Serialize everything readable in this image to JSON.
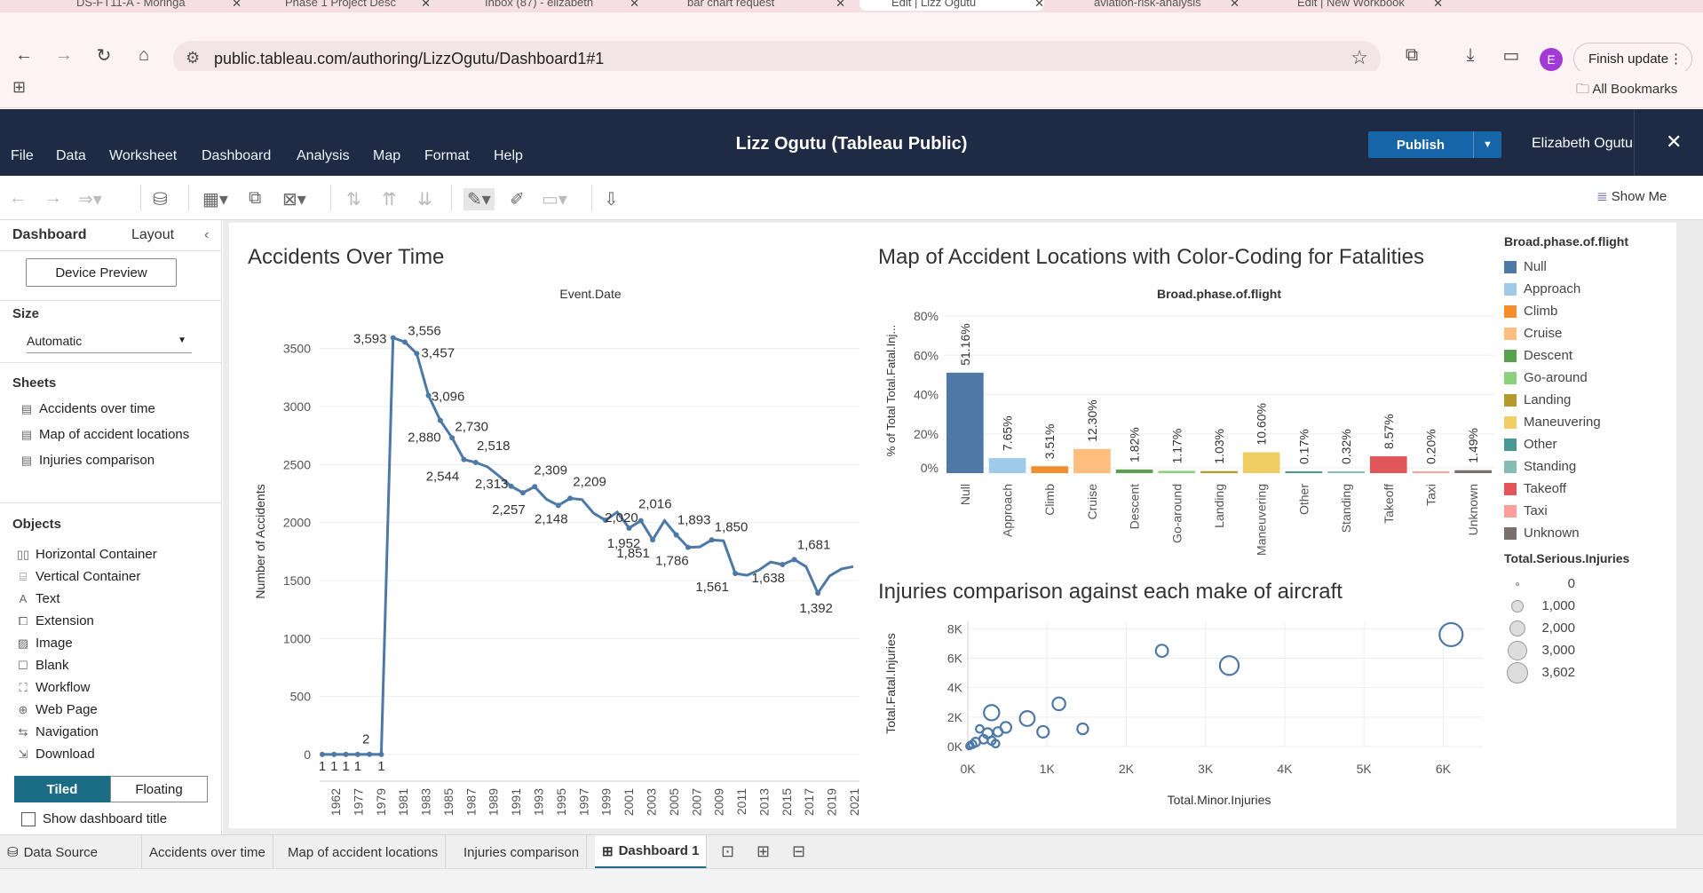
{
  "browser": {
    "tabs": [
      {
        "label": "DS-FT11-A - Moringa"
      },
      {
        "label": "Phase 1 Project Desc"
      },
      {
        "label": "Inbox (87) - elizabeth"
      },
      {
        "label": "bar chart request"
      },
      {
        "label": "Edit | Lizz Ogutu"
      },
      {
        "label": "aviation-risk-analysis"
      },
      {
        "label": "Edit | New Workbook"
      }
    ],
    "url": "public.tableau.com/authoring/LizzOgutu/Dashboard1#1",
    "profile_initial": "E",
    "finish_update": "Finish update",
    "all_bookmarks": "All Bookmarks"
  },
  "tableau": {
    "menu": [
      "File",
      "Data",
      "Worksheet",
      "Dashboard",
      "Analysis",
      "Map",
      "Format",
      "Help"
    ],
    "title": "Lizz Ogutu (Tableau Public)",
    "publish": "Publish",
    "user": "Elizabeth Ogutu",
    "show_me": "Show Me"
  },
  "left_pane": {
    "tab_dashboard": "Dashboard",
    "tab_layout": "Layout",
    "device_preview": "Device Preview",
    "size_heading": "Size",
    "size_value": "Automatic",
    "sheets_heading": "Sheets",
    "sheets": [
      "Accidents over time",
      "Map of accident locations",
      "Injuries comparison"
    ],
    "objects_heading": "Objects",
    "objects": [
      "Horizontal Container",
      "Vertical Container",
      "Text",
      "Extension",
      "Image",
      "Blank",
      "Workflow",
      "Web Page",
      "Navigation",
      "Download"
    ],
    "tiled": "Tiled",
    "floating": "Floating",
    "show_title": "Show dashboard title"
  },
  "bottom_tabs": {
    "data_source": "Data Source",
    "sheets": [
      "Accidents over time",
      "Map of accident locations",
      "Injuries comparison"
    ],
    "active": "Dashboard 1"
  },
  "chart_data": [
    {
      "type": "line",
      "title": "Accidents Over Time",
      "header": "Event.Date",
      "ylabel": "Number of Accidents",
      "ylim": [
        0,
        3600
      ],
      "yticks": [
        0,
        500,
        1000,
        1500,
        2000,
        2500,
        3000,
        3500
      ],
      "xticks": [
        "1962",
        "1977",
        "1979",
        "1981",
        "1983",
        "1985",
        "1987",
        "1989",
        "1991",
        "1993",
        "1995",
        "1997",
        "1999",
        "2001",
        "2003",
        "2005",
        "2007",
        "2009",
        "2011",
        "2013",
        "2015",
        "2017",
        "2019",
        "2021"
      ],
      "x": [
        1962,
        1974,
        1977,
        1979,
        1981,
        1982,
        1983,
        1984,
        1985,
        1986,
        1987,
        1988,
        1989,
        1990,
        1991,
        1992,
        1993,
        1994,
        1995,
        1996,
        1997,
        1998,
        1999,
        2000,
        2001,
        2002,
        2003,
        2004,
        2005,
        2006,
        2007,
        2008,
        2009,
        2010,
        2011,
        2012,
        2013,
        2014,
        2015,
        2016,
        2017,
        2018,
        2019,
        2020,
        2021,
        2022
      ],
      "values": [
        1,
        1,
        1,
        1,
        2,
        1,
        3593,
        3556,
        3457,
        3096,
        2880,
        2730,
        2544,
        2518,
        2313,
        2257,
        2309,
        2148,
        2209,
        2020,
        1952,
        2016,
        1851,
        1893,
        1786,
        1850,
        1561,
        1638,
        1681,
        1392,
        1558,
        1622
      ],
      "labels_shown": [
        "1",
        "1",
        "1",
        "1",
        "2",
        "1",
        "3,593",
        "3,556",
        "3,457",
        "3,096",
        "2,880",
        "2,730",
        "2,544",
        "2,518",
        "2,313",
        "2,257",
        "2,309",
        "2,148",
        "2,209",
        "2,020",
        "1,952",
        "2,016",
        "1,851",
        "1,893",
        "1,786",
        "1,850",
        "1,561",
        "1,638",
        "1,681",
        "1,392"
      ],
      "series_values": [
        1,
        1,
        1,
        1,
        2,
        1,
        3593,
        3556,
        3457,
        3096,
        2880,
        2730,
        2544,
        2518,
        2480,
        2400,
        2313,
        2257,
        2309,
        2200,
        2148,
        2209,
        2198,
        2080,
        2020,
        2090,
        1952,
        2016,
        1851,
        2016,
        1893,
        1786,
        1790,
        1850,
        1843,
        1561,
        1545,
        1590,
        1660,
        1638,
        1681,
        1620,
        1392,
        1540,
        1600,
        1620
      ],
      "color": "#4e79a7"
    },
    {
      "type": "bar",
      "title": "Map of Accident Locations with Color-Coding for Fatalities",
      "header": "Broad.phase.of.flight",
      "ylabel": "% of Total Total.Fatal.Inj...",
      "yticks": [
        "0%",
        "20%",
        "40%",
        "60%",
        "80%"
      ],
      "ylim": [
        0,
        80
      ],
      "categories": [
        "Null",
        "Approach",
        "Climb",
        "Cruise",
        "Descent",
        "Go-around",
        "Landing",
        "Maneuvering",
        "Other",
        "Standing",
        "Takeoff",
        "Taxi",
        "Unknown"
      ],
      "values": [
        51.16,
        7.65,
        3.51,
        12.3,
        1.82,
        1.17,
        1.03,
        10.6,
        0.17,
        0.32,
        8.57,
        0.2,
        1.49
      ],
      "value_labels": [
        "51.16%",
        "7.65%",
        "3.51%",
        "12.30%",
        "1.82%",
        "1.17%",
        "1.03%",
        "10.60%",
        "0.17%",
        "0.32%",
        "8.57%",
        "0.20%",
        "1.49%"
      ],
      "colors": [
        "#4e79a7",
        "#a0cbe8",
        "#f28e2b",
        "#ffbe7d",
        "#59a14f",
        "#8cd17d",
        "#b6992d",
        "#f1ce63",
        "#499894",
        "#86bcb6",
        "#e15759",
        "#ff9d9a",
        "#79706e"
      ]
    },
    {
      "type": "scatter",
      "title": "Injuries comparison against each make of aircraft",
      "xlabel": "Total.Minor.Injuries",
      "ylabel": "Total.Fatal.Injuries",
      "xticks": [
        "0K",
        "1K",
        "2K",
        "3K",
        "4K",
        "5K",
        "6K"
      ],
      "yticks": [
        "0K",
        "2K",
        "4K",
        "6K",
        "8K"
      ],
      "xlim": [
        0,
        6500
      ],
      "ylim": [
        0,
        8500
      ],
      "points": [
        {
          "x": 6100,
          "y": 7600,
          "size": 3602
        },
        {
          "x": 3300,
          "y": 5500,
          "size": 2200
        },
        {
          "x": 2450,
          "y": 6500,
          "size": 700
        },
        {
          "x": 1150,
          "y": 2900,
          "size": 800
        },
        {
          "x": 1450,
          "y": 1200,
          "size": 500
        },
        {
          "x": 750,
          "y": 1900,
          "size": 1200
        },
        {
          "x": 950,
          "y": 1000,
          "size": 600
        },
        {
          "x": 300,
          "y": 2300,
          "size": 1300
        },
        {
          "x": 480,
          "y": 1300,
          "size": 500
        },
        {
          "x": 380,
          "y": 1000,
          "size": 300
        },
        {
          "x": 250,
          "y": 900,
          "size": 400
        },
        {
          "x": 200,
          "y": 500,
          "size": 250
        },
        {
          "x": 150,
          "y": 1200,
          "size": 150
        },
        {
          "x": 100,
          "y": 300,
          "size": 250
        },
        {
          "x": 60,
          "y": 150,
          "size": 150
        },
        {
          "x": 30,
          "y": 80,
          "size": 100
        },
        {
          "x": 20,
          "y": 30,
          "size": 80
        },
        {
          "x": 300,
          "y": 400,
          "size": 200
        },
        {
          "x": 350,
          "y": 200,
          "size": 150
        }
      ],
      "color": "#4e79a7"
    }
  ],
  "legend": {
    "color_title": "Broad.phase.of.flight",
    "color_items": [
      {
        "label": "Null",
        "color": "#4e79a7"
      },
      {
        "label": "Approach",
        "color": "#a0cbe8"
      },
      {
        "label": "Climb",
        "color": "#f28e2b"
      },
      {
        "label": "Cruise",
        "color": "#ffbe7d"
      },
      {
        "label": "Descent",
        "color": "#59a14f"
      },
      {
        "label": "Go-around",
        "color": "#8cd17d"
      },
      {
        "label": "Landing",
        "color": "#b6992d"
      },
      {
        "label": "Maneuvering",
        "color": "#f1ce63"
      },
      {
        "label": "Other",
        "color": "#499894"
      },
      {
        "label": "Standing",
        "color": "#86bcb6"
      },
      {
        "label": "Takeoff",
        "color": "#e15759"
      },
      {
        "label": "Taxi",
        "color": "#ff9d9a"
      },
      {
        "label": "Unknown",
        "color": "#79706e"
      }
    ],
    "size_title": "Total.Serious.Injuries",
    "size_items": [
      "0",
      "1,000",
      "2,000",
      "3,000",
      "3,602"
    ]
  }
}
